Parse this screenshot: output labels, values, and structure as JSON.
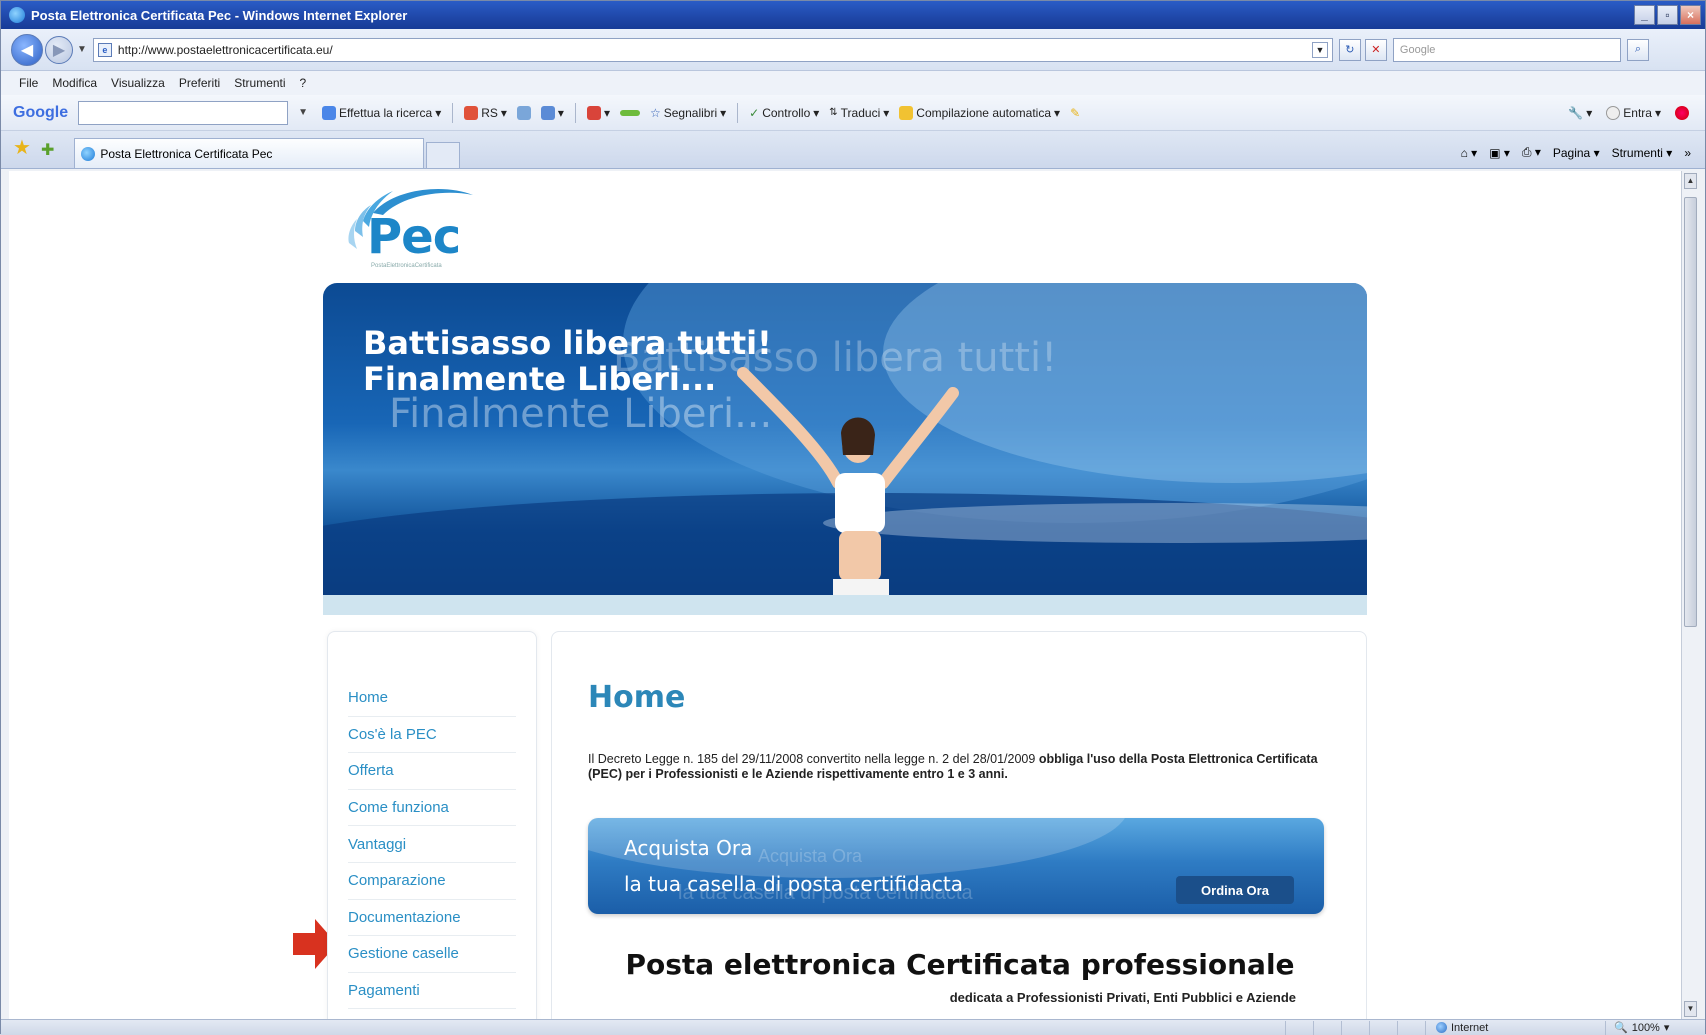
{
  "window": {
    "title": "Posta Elettronica Certificata Pec - Windows Internet Explorer",
    "buttons": [
      "_",
      "▫",
      "×"
    ]
  },
  "address_bar": {
    "url": "http://www.postaelettronicacertificata.eu/",
    "search_placeholder": "Google"
  },
  "menu": [
    "File",
    "Modifica",
    "Visualizza",
    "Preferiti",
    "Strumenti",
    "?"
  ],
  "google_toolbar": {
    "logo": "Google",
    "items": [
      "Effettua la ricerca",
      "RS",
      "Segnalibri",
      "Controllo",
      "Traduci",
      "Compilazione automatica"
    ],
    "right_items": [
      "Entra"
    ]
  },
  "tabs": {
    "active_tab": "Posta Elettronica Certificata Pec",
    "commands": [
      "Pagina",
      "Strumenti"
    ]
  },
  "page": {
    "logo_text": "Pec",
    "logo_sub": "PostaElettronicaCertificata",
    "banner": {
      "line1": "Battisasso libera tutti!",
      "line2": "Finalmente Liberi...",
      "ghost1": "Battisasso libera tutti!",
      "ghost2": "Finalmente Liberi..."
    },
    "nav": [
      "Home",
      "Cos'è la PEC",
      "Offerta",
      "Come funziona",
      "Vantaggi",
      "Comparazione",
      "Documentazione",
      "Gestione caselle",
      "Pagamenti"
    ],
    "main": {
      "heading": "Home",
      "intro_plain": "Il Decreto Legge n. 185 del 29/11/2008 convertito nella legge n. 2 del 28/01/2009 ",
      "intro_bold": "obbliga l'uso della Posta Elettronica Certificata (PEC) per i Professionisti e le Aziende rispettivamente entro 1 e 3 anni.",
      "cta_line1": "Acquista Ora",
      "cta_line2": "la tua casella di posta certifidacta",
      "cta_ghost1": "Acquista Ora",
      "cta_ghost2": "la tua casella di posta certifidacta",
      "cta_button": "Ordina Ora",
      "title2": "Posta elettronica Certificata professionale",
      "subtitle2": "dedicata a Professionisti Privati, Enti Pubblici e Aziende"
    }
  },
  "status": {
    "zone": "Internet",
    "zoom": "100%"
  },
  "colors": {
    "link": "#2a8fc5",
    "heading": "#2c87b8",
    "arrow": "#d8321f",
    "titlebar": "#1f47a8"
  }
}
